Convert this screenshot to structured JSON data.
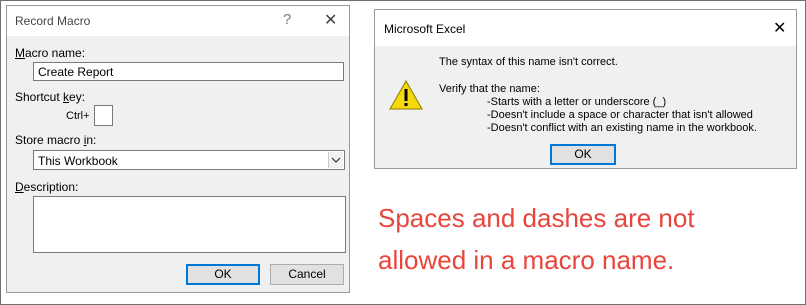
{
  "record_macro": {
    "title": "Record Macro",
    "help_glyph": "?",
    "close_glyph": "✕",
    "macro_name_label": {
      "underlined": "M",
      "rest": "acro name:"
    },
    "macro_name_value": "Create Report",
    "shortcut_key_label": {
      "pre": "Shortcut ",
      "underlined": "k",
      "rest": "ey:"
    },
    "ctrl_plus": "Ctrl+",
    "shortcut_value": "",
    "store_macro_label": {
      "pre": "Store macro ",
      "underlined": "i",
      "rest": "n:"
    },
    "store_macro_value": "This Workbook",
    "description_label": {
      "underlined": "D",
      "rest": "escription:"
    },
    "description_value": "",
    "ok_label": "OK",
    "cancel_label": "Cancel"
  },
  "excel_dialog": {
    "title": "Microsoft Excel",
    "close_glyph": "✕",
    "icon": "warning-icon",
    "message_line1": "The syntax of this name isn't correct.",
    "message_line2": "Verify that the name:",
    "rules": [
      "-Starts with a letter or underscore (_)",
      "-Doesn't include a space or character that isn't allowed",
      "-Doesn't conflict with an existing name in the workbook."
    ],
    "ok_label": "OK"
  },
  "caption": {
    "line1": "Spaces and dashes are not",
    "line2": "allowed in a macro name."
  },
  "colors": {
    "caption": "#e8453c",
    "warning_fill": "#f5d90a",
    "default_button_border": "#0078d7"
  }
}
